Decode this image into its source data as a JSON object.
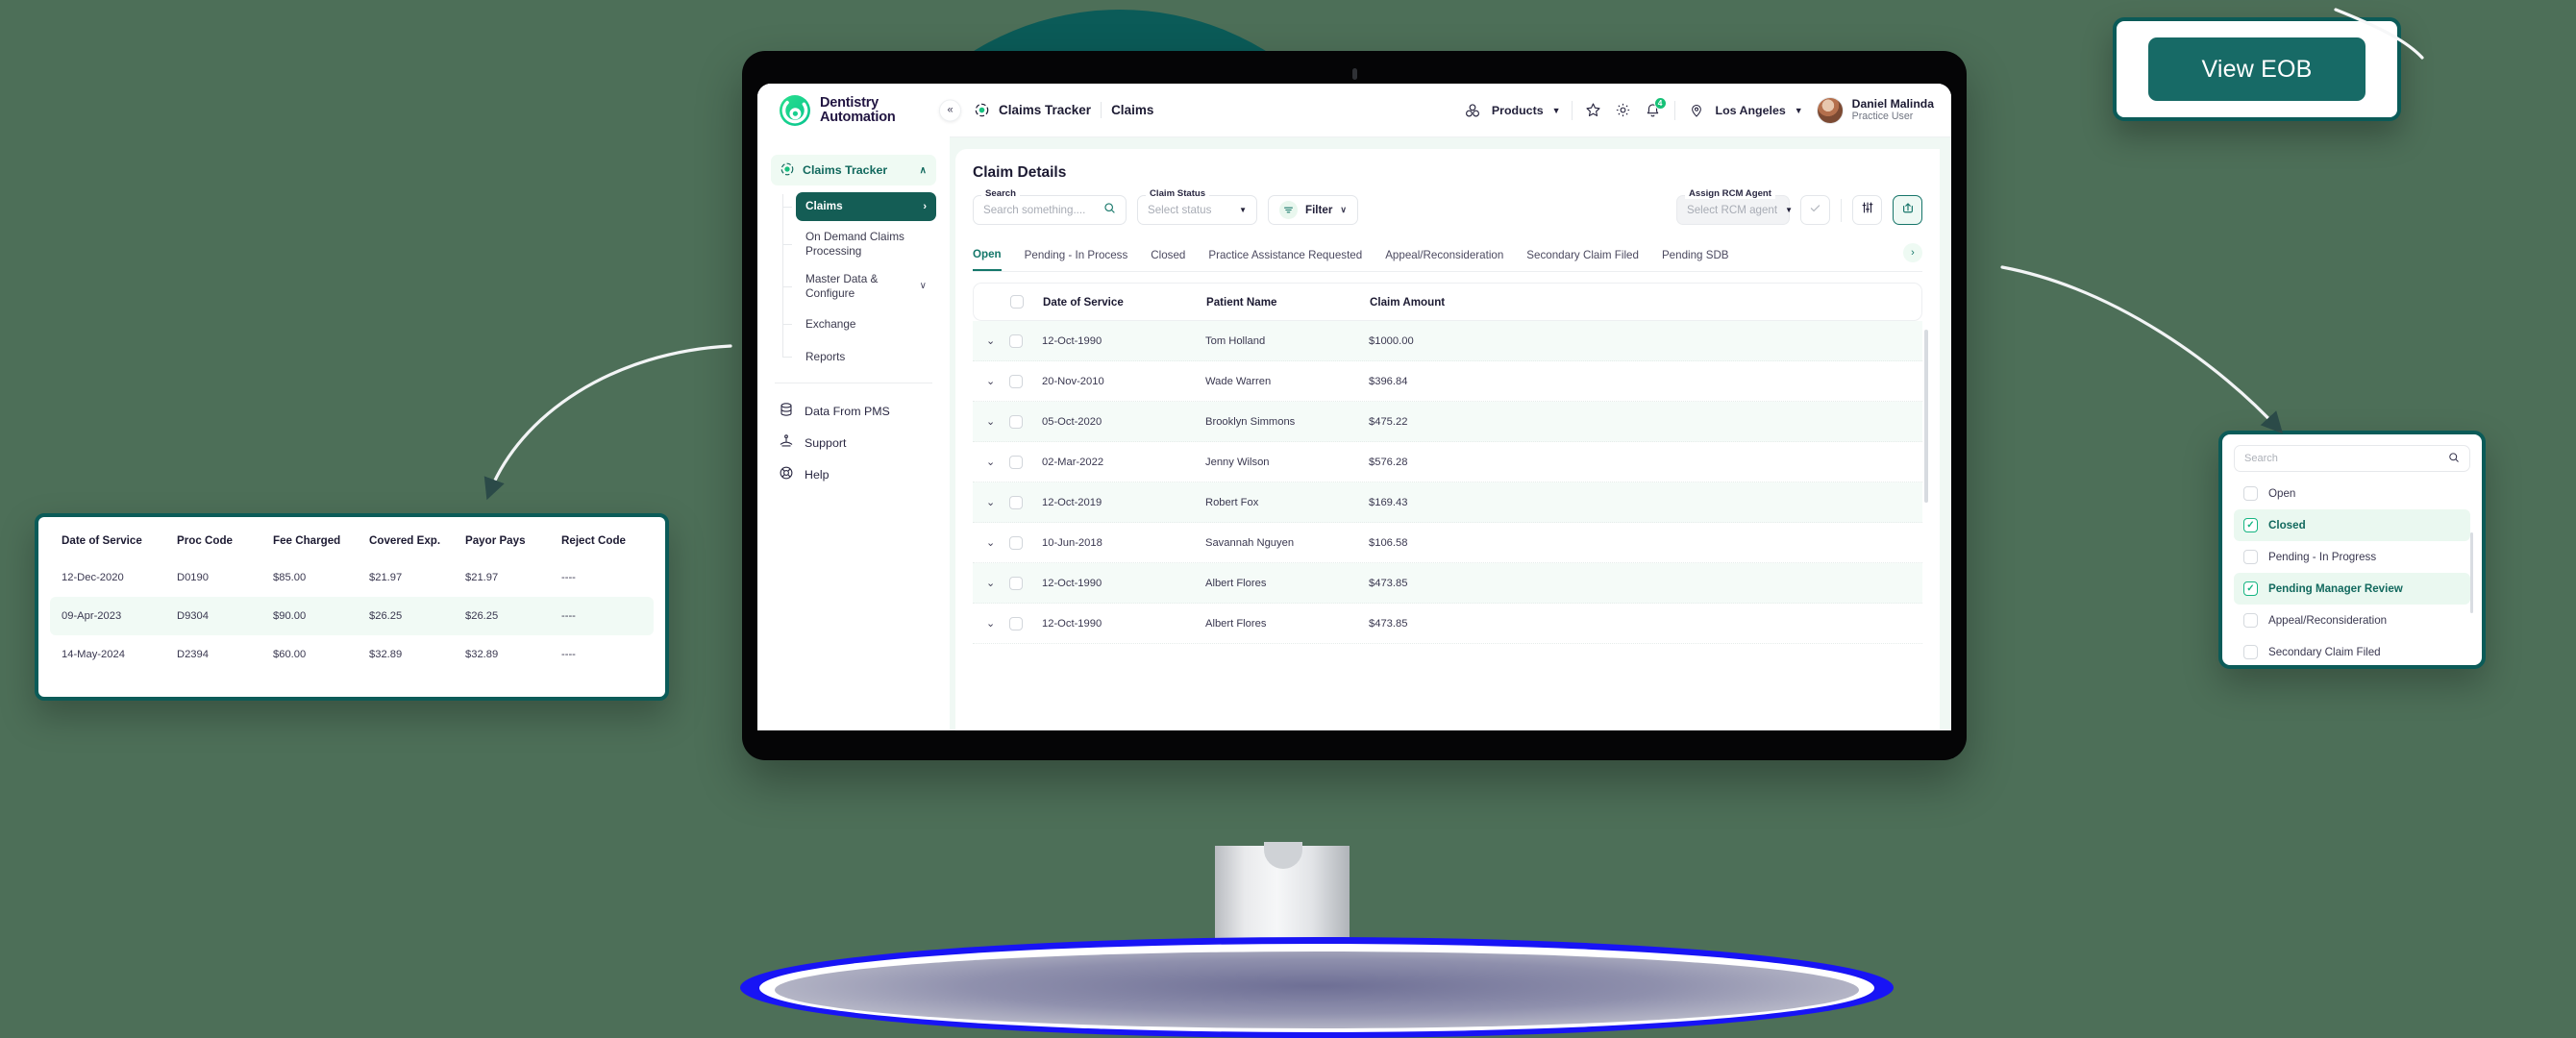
{
  "brand": {
    "line1": "Dentistry",
    "line2": "Automation",
    "logo_icon": "dentistry-logo-icon"
  },
  "topbar": {
    "collapse_icon": "collapse-left-icon",
    "breadcrumb": {
      "icon": "claims-tracker-icon",
      "root": "Claims Tracker",
      "current": "Claims"
    },
    "products_label": "Products",
    "products_icon": "products-icon",
    "star_icon": "star-icon",
    "gear_icon": "gear-icon",
    "bell_icon": "bell-icon",
    "bell_count": "4",
    "location_icon": "location-pin-icon",
    "location_label": "Los Angeles",
    "user": {
      "name": "Daniel Malinda",
      "role": "Practice User",
      "avatar": "user-avatar"
    }
  },
  "sidebar": {
    "group": {
      "label": "Claims Tracker",
      "icon": "claims-tracker-icon",
      "chevron": "∧"
    },
    "sub_items": [
      {
        "label": "Claims",
        "active": true,
        "trailing": "›"
      },
      {
        "label": "On Demand Claims Processing",
        "active": false,
        "trailing": ""
      },
      {
        "label": "Master Data & Configure",
        "active": false,
        "trailing": "∨"
      },
      {
        "label": "Exchange",
        "active": false,
        "trailing": ""
      },
      {
        "label": "Reports",
        "active": false,
        "trailing": ""
      }
    ],
    "flat_items": [
      {
        "label": "Data From PMS",
        "icon": "database-icon"
      },
      {
        "label": "Support",
        "icon": "support-hand-icon"
      },
      {
        "label": "Help",
        "icon": "help-lifebuoy-icon"
      }
    ]
  },
  "main": {
    "title": "Claim Details",
    "search": {
      "legend": "Search",
      "placeholder": "Search something....",
      "icon": "search-icon"
    },
    "claim_status": {
      "legend": "Claim Status",
      "placeholder": "Select status",
      "caret": "▼"
    },
    "filter": {
      "label": "Filter",
      "icon": "filter-icon",
      "chevron": "∨"
    },
    "assign_rcm": {
      "legend": "Assign RCM Agent",
      "placeholder": "Select RCM agent",
      "caret": "▼"
    },
    "check_button": {
      "icon": "check-icon"
    },
    "settings_button": {
      "icon": "sliders-icon"
    },
    "export_button": {
      "icon": "export-up-icon"
    },
    "tabs": [
      {
        "label": "Open",
        "active": true
      },
      {
        "label": "Pending - In Process",
        "active": false
      },
      {
        "label": "Closed",
        "active": false
      },
      {
        "label": "Practice Assistance Requested",
        "active": false
      },
      {
        "label": "Appeal/Reconsideration",
        "active": false
      },
      {
        "label": "Secondary Claim Filed",
        "active": false
      },
      {
        "label": "Pending SDB",
        "active": false
      }
    ],
    "tabs_next_icon": "chevron-right-icon",
    "table": {
      "columns": [
        "Date of Service",
        "Patient Name",
        "Claim Amount"
      ],
      "rows": [
        {
          "date": "12-Oct-1990",
          "patient": "Tom Holland",
          "amount": "$1000.00"
        },
        {
          "date": "20-Nov-2010",
          "patient": "Wade Warren",
          "amount": "$396.84"
        },
        {
          "date": "05-Oct-2020",
          "patient": "Brooklyn Simmons",
          "amount": "$475.22"
        },
        {
          "date": "02-Mar-2022",
          "patient": "Jenny Wilson",
          "amount": "$576.28"
        },
        {
          "date": "12-Oct-2019",
          "patient": "Robert Fox",
          "amount": "$169.43"
        },
        {
          "date": "10-Jun-2018",
          "patient": "Savannah Nguyen",
          "amount": "$106.58"
        },
        {
          "date": "12-Oct-1990",
          "patient": "Albert Flores",
          "amount": "$473.85"
        },
        {
          "date": "12-Oct-1990",
          "patient": "Albert Flores",
          "amount": "$473.85"
        }
      ]
    }
  },
  "detail_table": {
    "columns": [
      "Date of Service",
      "Proc Code",
      "Fee Charged",
      "Covered Exp.",
      "Payor Pays",
      "Reject Code"
    ],
    "rows": [
      {
        "date": "12-Dec-2020",
        "proc": "D0190",
        "fee": "$85.00",
        "covered": "$21.97",
        "payor": "$21.97",
        "reject": "----"
      },
      {
        "date": "09-Apr-2023",
        "proc": "D9304",
        "fee": "$90.00",
        "covered": "$26.25",
        "payor": "$26.25",
        "reject": "----"
      },
      {
        "date": "14-May-2024",
        "proc": "D2394",
        "fee": "$60.00",
        "covered": "$32.89",
        "payor": "$32.89",
        "reject": "----"
      }
    ]
  },
  "status_dropdown": {
    "search_placeholder": "Search",
    "search_icon": "search-icon",
    "options": [
      {
        "label": "Open",
        "checked": false
      },
      {
        "label": "Closed",
        "checked": true
      },
      {
        "label": "Pending - In Progress",
        "checked": false
      },
      {
        "label": "Pending Manager Review",
        "checked": true
      },
      {
        "label": "Appeal/Reconsideration",
        "checked": false
      },
      {
        "label": "Secondary Claim Filed",
        "checked": false
      }
    ]
  },
  "eob": {
    "label": "View EOB"
  },
  "colors": {
    "brand_teal": "#145d55",
    "accent_green": "#16c177",
    "circle_teal": "#0b5b58",
    "tab_active": "#14776a",
    "page_bg": "#4d6f58",
    "base_outline": "#1814f5"
  }
}
